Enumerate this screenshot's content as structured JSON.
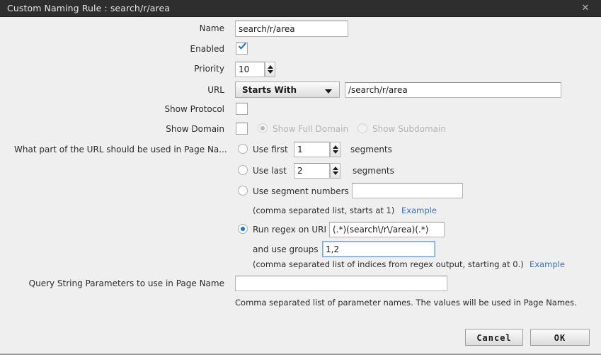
{
  "window": {
    "title": "Custom Naming Rule : search/r/area",
    "close_icon": "close-icon"
  },
  "form": {
    "name_label": "Name",
    "name_value": "search/r/area",
    "enabled_label": "Enabled",
    "enabled_checked": true,
    "priority_label": "Priority",
    "priority_value": "10",
    "url_label": "URL",
    "url_match_type": "Starts With",
    "url_value": "/search/r/area",
    "show_protocol_label": "Show Protocol",
    "show_protocol_checked": false,
    "show_domain_label": "Show Domain",
    "show_domain_checked": false,
    "show_full_domain_label": "Show Full Domain",
    "show_subdomain_label": "Show Subdomain"
  },
  "url_part": {
    "question_label": "What part of the URL should be used in Page Na...",
    "use_first_label": "Use first",
    "use_first_value": "1",
    "use_first_suffix": "segments",
    "use_last_label": "Use last",
    "use_last_value": "2",
    "use_last_suffix": "segments",
    "use_segment_numbers_label": "Use segment numbers",
    "use_segment_numbers_value": "",
    "segments_hint": "(comma separated list, starts at 1)",
    "segments_example_link": "Example",
    "run_regex_label": "Run regex on URI",
    "run_regex_value": "(.*)(search\\/r\\/area)(.*)",
    "and_use_groups_label": "and use groups",
    "and_use_groups_value": "1,2",
    "groups_hint": "(comma separated list of indices from regex output, starting at 0.)",
    "groups_example_link": "Example"
  },
  "query_string": {
    "label": "Query String Parameters to use in Page Name",
    "value": "",
    "hint": "Comma separated list of parameter names. The values will be used in Page Names."
  },
  "footer": {
    "cancel_label": "Cancel",
    "ok_label": "OK"
  }
}
